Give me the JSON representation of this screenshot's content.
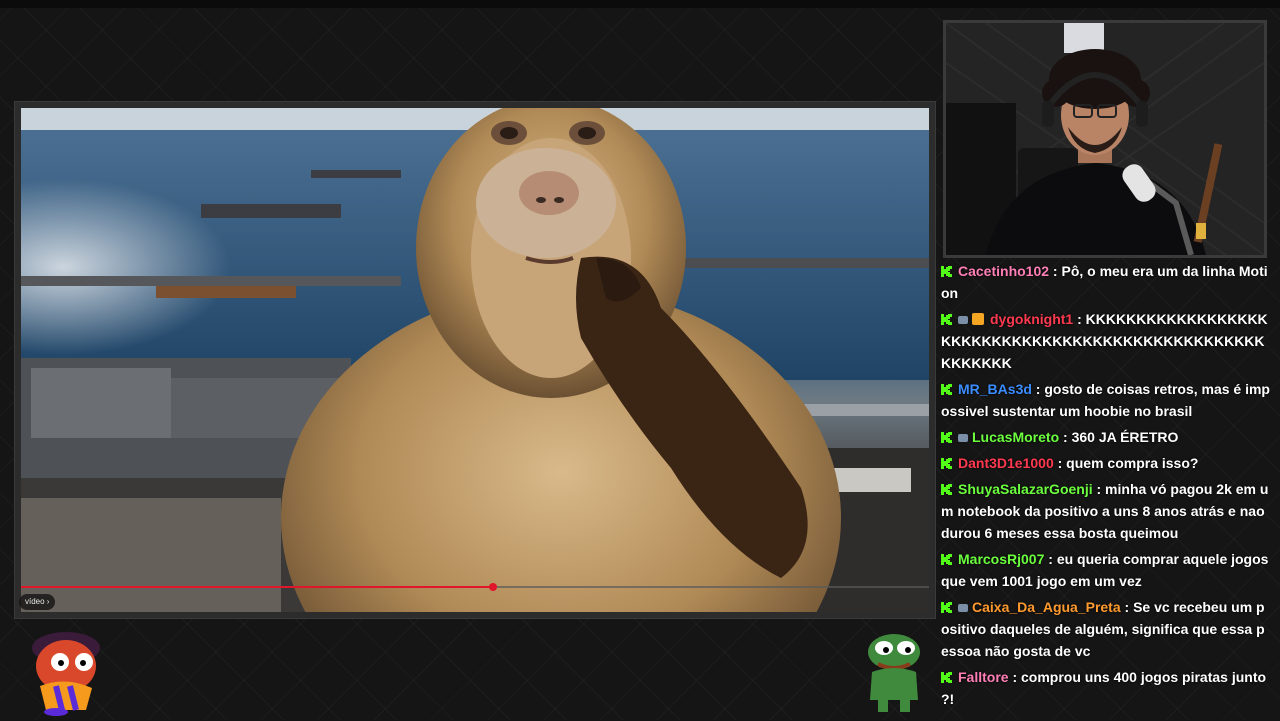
{
  "video": {
    "progress_percent": 52,
    "chip_label": "vídeo ›"
  },
  "chat": {
    "messages": [
      {
        "user": "Cacetinho102",
        "user_color": "#ff7fb6",
        "badges": [
          "kick"
        ],
        "text": " : Pô, o meu era um da linha Motion"
      },
      {
        "user": "dygoknight1",
        "user_color": "#ff3a50",
        "badges": [
          "kick",
          "sub",
          "crown"
        ],
        "text": " : KKKKKKKKKKKKKKKKKKKKKKKKKKKKKKKKKKKKKKKKKKKKKKKKKKKKKKKKK"
      },
      {
        "user": "MR_BAs3d",
        "user_color": "#3b8cff",
        "badges": [
          "kick"
        ],
        "text": " : gosto de coisas retros, mas é impossivel sustentar um hoobie no brasil"
      },
      {
        "user": "LucasMoreto",
        "user_color": "#6cff3f",
        "badges": [
          "kick",
          "sub"
        ],
        "text": " : 360 JA ÉRETRO"
      },
      {
        "user": "Dant3D1e1000",
        "user_color": "#ff3a50",
        "badges": [
          "kick"
        ],
        "text": " : quem compra isso?"
      },
      {
        "user": "ShuyaSalazarGoenji",
        "user_color": "#6cff3f",
        "badges": [
          "kick"
        ],
        "text": " : minha vó pagou 2k em um notebook da positivo a uns 8 anos atrás e nao durou 6 meses essa bosta queimou"
      },
      {
        "user": "MarcosRj007",
        "user_color": "#6cff3f",
        "badges": [
          "kick"
        ],
        "text": " : eu queria comprar aquele jogos que vem 1001 jogo em um vez"
      },
      {
        "user": "Caixa_Da_Agua_Preta",
        "user_color": "#ff9a2e",
        "badges": [
          "kick",
          "sub"
        ],
        "text": " : Se vc recebeu um positivo daqueles de alguém, significa que essa pessoa não gosta de vc"
      },
      {
        "user": "Falltore",
        "user_color": "#ff7fb6",
        "badges": [
          "kick"
        ],
        "text": " : comprou uns 400 jogos piratas junto ?!"
      }
    ]
  },
  "colors": {
    "kick_green": "#53fc18",
    "progress_red": "#e0162b"
  }
}
